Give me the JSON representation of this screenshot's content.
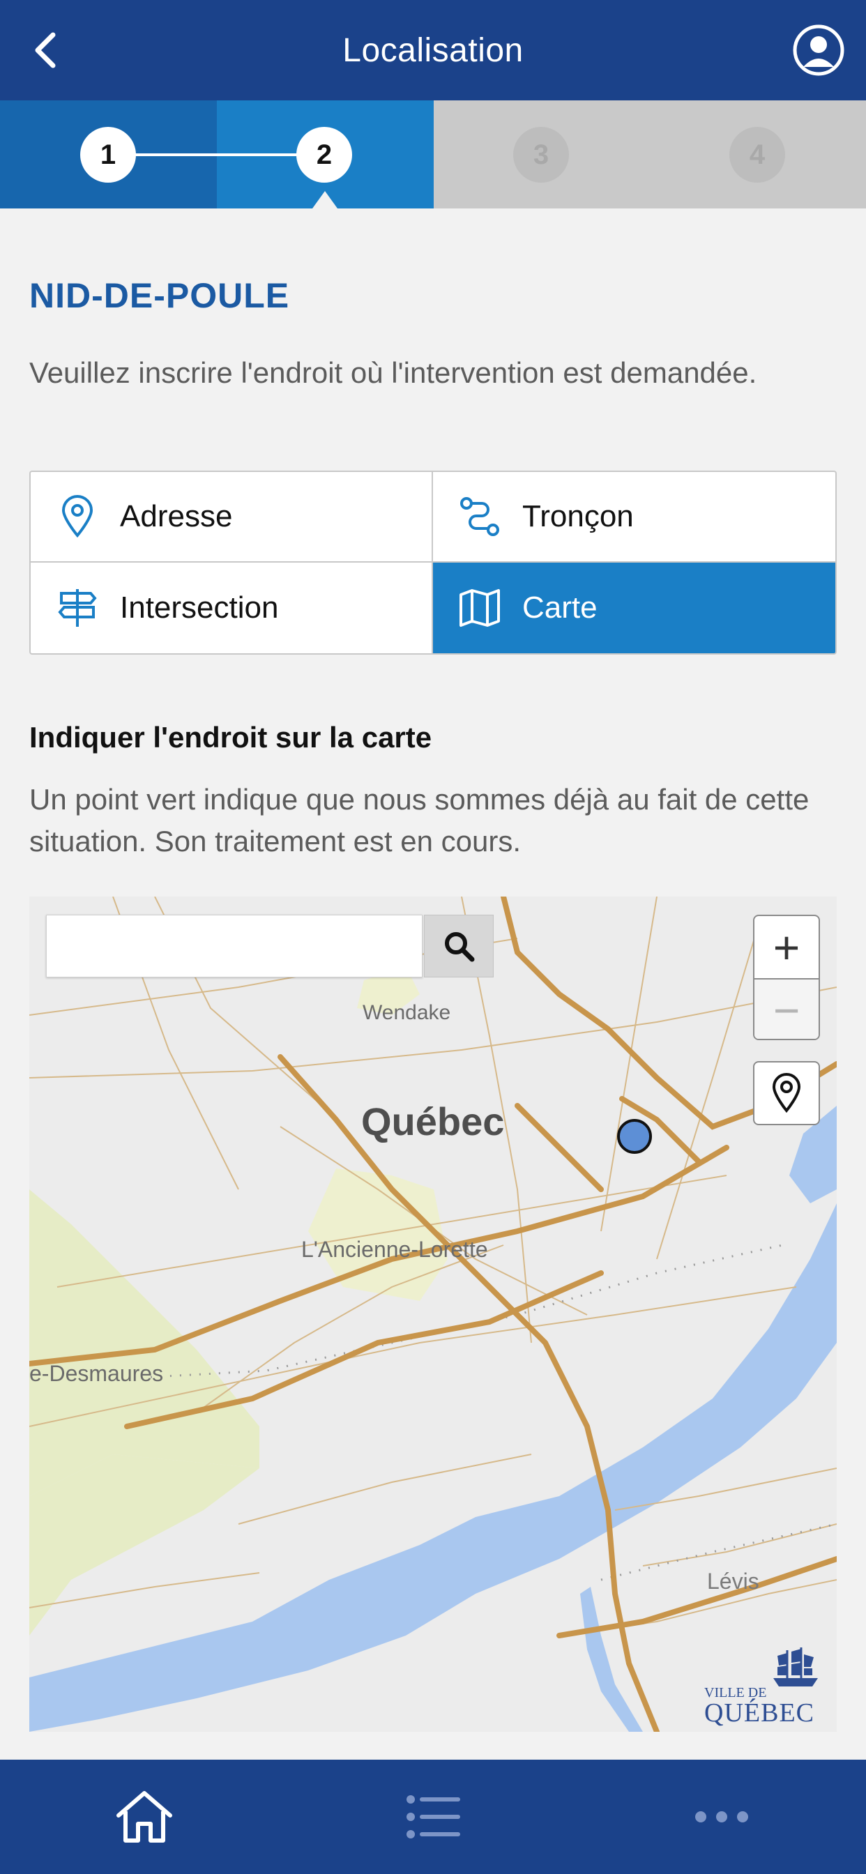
{
  "header": {
    "title": "Localisation",
    "back_icon": "chevron-left-icon",
    "account_icon": "user-circle-icon"
  },
  "stepper": {
    "steps": [
      "1",
      "2",
      "3",
      "4"
    ],
    "current_step": 2
  },
  "section_title": "NID-DE-POULE",
  "description": "Veuillez inscrire l'endroit où l'intervention est demandée.",
  "location_options": [
    {
      "label": "Adresse",
      "icon": "map-pin-icon",
      "selected": false
    },
    {
      "label": "Tronçon",
      "icon": "route-icon",
      "selected": false
    },
    {
      "label": "Intersection",
      "icon": "signpost-icon",
      "selected": false
    },
    {
      "label": "Carte",
      "icon": "map-icon",
      "selected": true
    }
  ],
  "map_section": {
    "heading": "Indiquer l'endroit sur la carte",
    "description": "Un point vert indique que nous sommes déjà au fait de cette situation. Son traitement est en cours."
  },
  "map": {
    "search_value": "",
    "search_icon": "search-icon",
    "zoom_in_label": "+",
    "zoom_out_label": "−",
    "locate_icon": "map-pin-icon",
    "place_labels": [
      "Wendake",
      "Québec",
      "L'Ancienne-Lorette",
      "e-Desmaures",
      "Lévis"
    ],
    "logo_small": "VILLE DE",
    "logo_big": "QUÉBEC"
  },
  "bottom_nav": [
    {
      "icon": "home-icon"
    },
    {
      "icon": "list-icon"
    },
    {
      "icon": "more-icon"
    }
  ],
  "colors": {
    "primary": "#1b428a",
    "accent": "#1a7fc6",
    "title": "#1b5aa3",
    "road": "#c8954b",
    "water": "#a9c7ef"
  }
}
